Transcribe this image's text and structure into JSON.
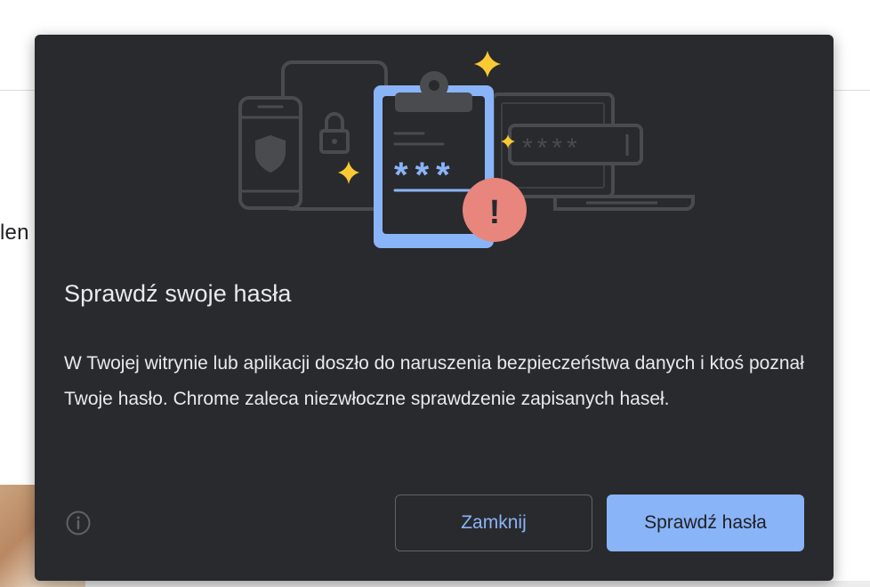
{
  "background": {
    "partial_text": "len"
  },
  "dialog": {
    "title": "Sprawdź swoje hasła",
    "body": "W Twojej witrynie lub aplikacji doszło do naruszenia bezpieczeństwa danych i ktoś poznał Twoje hasło. Chrome zaleca niezwłoczne sprawdzenie zapisanych haseł.",
    "buttons": {
      "close_label": "Zamknij",
      "check_label": "Sprawdź hasła"
    },
    "illustration": {
      "masked_password": "***",
      "password_field_mask": "****",
      "alert_mark": "!"
    }
  },
  "colors": {
    "dialog_bg": "#292a2d",
    "text": "#e8eaed",
    "accent": "#8ab4f8",
    "alert": "#e8867d",
    "sparkle": "#fcc934"
  },
  "icons": {
    "info": "info-circle-icon",
    "shield": "shield-icon",
    "lock": "lock-icon",
    "sparkle": "sparkle-icon",
    "alert": "exclamation-icon"
  }
}
